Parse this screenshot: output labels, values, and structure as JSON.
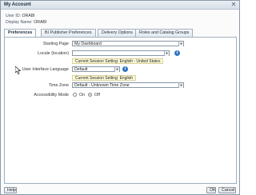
{
  "dialog": {
    "title": "My Account",
    "close_glyph": "✕"
  },
  "account": {
    "user_id_label": "User ID:",
    "user_id_value": "ORABI",
    "display_name_label": "Display Name:",
    "display_name_value": "ORABI"
  },
  "tabs": [
    {
      "label": "Preferences",
      "active": true
    },
    {
      "label": "BI Publisher Preferences",
      "active": false
    },
    {
      "label": "Delivery Options",
      "active": false
    },
    {
      "label": "Roles and Catalog Groups",
      "active": false
    }
  ],
  "form": {
    "starting_page": {
      "label": "Starting Page",
      "value": "My Dashboard"
    },
    "locale": {
      "label": "Locale (location)",
      "value": "",
      "note": "Current Session Setting: English - United States"
    },
    "ui_language": {
      "label": "User Interface Language",
      "value": "Default",
      "note": "Current Session Setting: English"
    },
    "time_zone": {
      "label": "Time Zone",
      "value": "Default - Unknown Time Zone"
    },
    "accessibility": {
      "label": "Accessibility Mode",
      "options": [
        "On",
        "Off"
      ],
      "selected": "Off"
    }
  },
  "footer": {
    "help_label": "Help",
    "ok_label": "OK",
    "cancel_label": "Cancel"
  },
  "colors": {
    "info_icon": "#2d74c4",
    "note_bg": "#fdfbd9"
  }
}
